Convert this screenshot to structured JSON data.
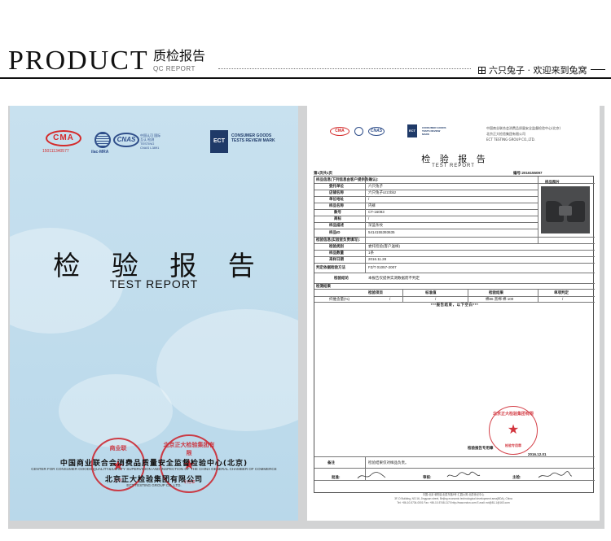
{
  "header": {
    "brand": "PRODUCT",
    "title_cn": "质检报告",
    "title_en": "QC REPORT",
    "slogan": "六只兔子 · 欢迎来到兔窝"
  },
  "cover": {
    "cma_text": "CMA",
    "cma_number": "150111340577",
    "ilac_text": "ilac-MRA",
    "cnas_text": "CNAS",
    "cnas_caption": "中国认可 国际互认 检测 TESTING CNAS L3891",
    "ect_text": "ECT",
    "ect_caption": "CONSUMER GOODS TESTS REVIEW MARK",
    "title_cn": "检 验 报 告",
    "title_en": "TEST REPORT",
    "org_cn": "中国商业联合会消费品质量安全监督检验中心(北京)",
    "org_en": "CENTER FOR CONSUMER GOODS QUALITY&SAFETY SUPERVISION AND INSPECTION OF THE CHINA GENERAL CHAMBER OF COMMERCE",
    "org2_cn": "北京正大检验集团有限公司",
    "org2_en": "ECT TESTING GROUP CO.,LTD.",
    "seal1_top": "商业联",
    "seal1_foot": "北京",
    "seal2_top": "北京正大检验集团有限",
    "seal2_foot": "专用章"
  },
  "report": {
    "org_lines": [
      "中国商业联合会消费品质量安全监督检验中心(北京)",
      "北京正大检验集团有限公司",
      "ECT TESTING GROUP CO.,LTD."
    ],
    "title_cn": "检 验 报 告",
    "title_en": "TEST REPORT",
    "page": "第1页共1页",
    "report_no": "编号:2016155097",
    "section_sample": "样品信息(下列信息由客户提供及确认):",
    "photo_label": "样品照片",
    "rows": [
      {
        "label": "委托单位",
        "value": "六只兔子"
      },
      {
        "label": "店铺名称",
        "value": "六只兔子xzzzbbz"
      },
      {
        "label": "单位地址",
        "value": "/"
      },
      {
        "label": "样品名称",
        "value": "内裤"
      },
      {
        "label": "款号",
        "value": "CT-16093"
      },
      {
        "label": "商标",
        "value": "/"
      },
      {
        "label": "样品描述",
        "value": "深蓝条纹"
      },
      {
        "label": "样品ID",
        "value": "5414155393635"
      }
    ],
    "section_lab": "检验信息(实验室负责填写):",
    "lab_rows": [
      {
        "label": "检验类别",
        "value": "委托检验(客户送样)"
      },
      {
        "label": "样品数量",
        "value": "1条"
      },
      {
        "label": "来样日期",
        "value": "2016.11.28"
      }
    ],
    "standard_label": "判定依据检验方法",
    "standard_value": "FZ/T 01057-2007",
    "conclusion_label": "检验结论",
    "conclusion_value": "本报告仅提供实测数据而不判定",
    "section_results": "检测结果",
    "result_headers": [
      "检验项目",
      "标准值",
      "检验结果",
      "单项判定"
    ],
    "result_row": [
      "纤维含量(%)",
      "/",
      "/",
      "棉86 黑棉 棉 100",
      "/"
    ],
    "end_line": "***报告结束，以下空白***",
    "seal_text": "北京正大检验集团有限",
    "seal_foot": "检验专用章",
    "seal_note": "检验报告专用章",
    "date": "2016.12.01",
    "remark_label": "备注",
    "remark_value": "检验结果仅对样品负责。",
    "sign_approve": "批准:",
    "sign_review": "审核:",
    "sign_main": "主检:",
    "footer_lines": [
      "中国·北京 朝阳区北辰东路8号 汇园公寓 北辰世纪中心",
      "3F, D Building, NO.16, Jingyuan street, Beijing economic technological development area(BDA), China",
      "Tel: +86-10-5734-0001   Fax: +86-10-5748-1170   http://www.ectcn.com   E-mail: ect@81-1@163.com"
    ]
  }
}
